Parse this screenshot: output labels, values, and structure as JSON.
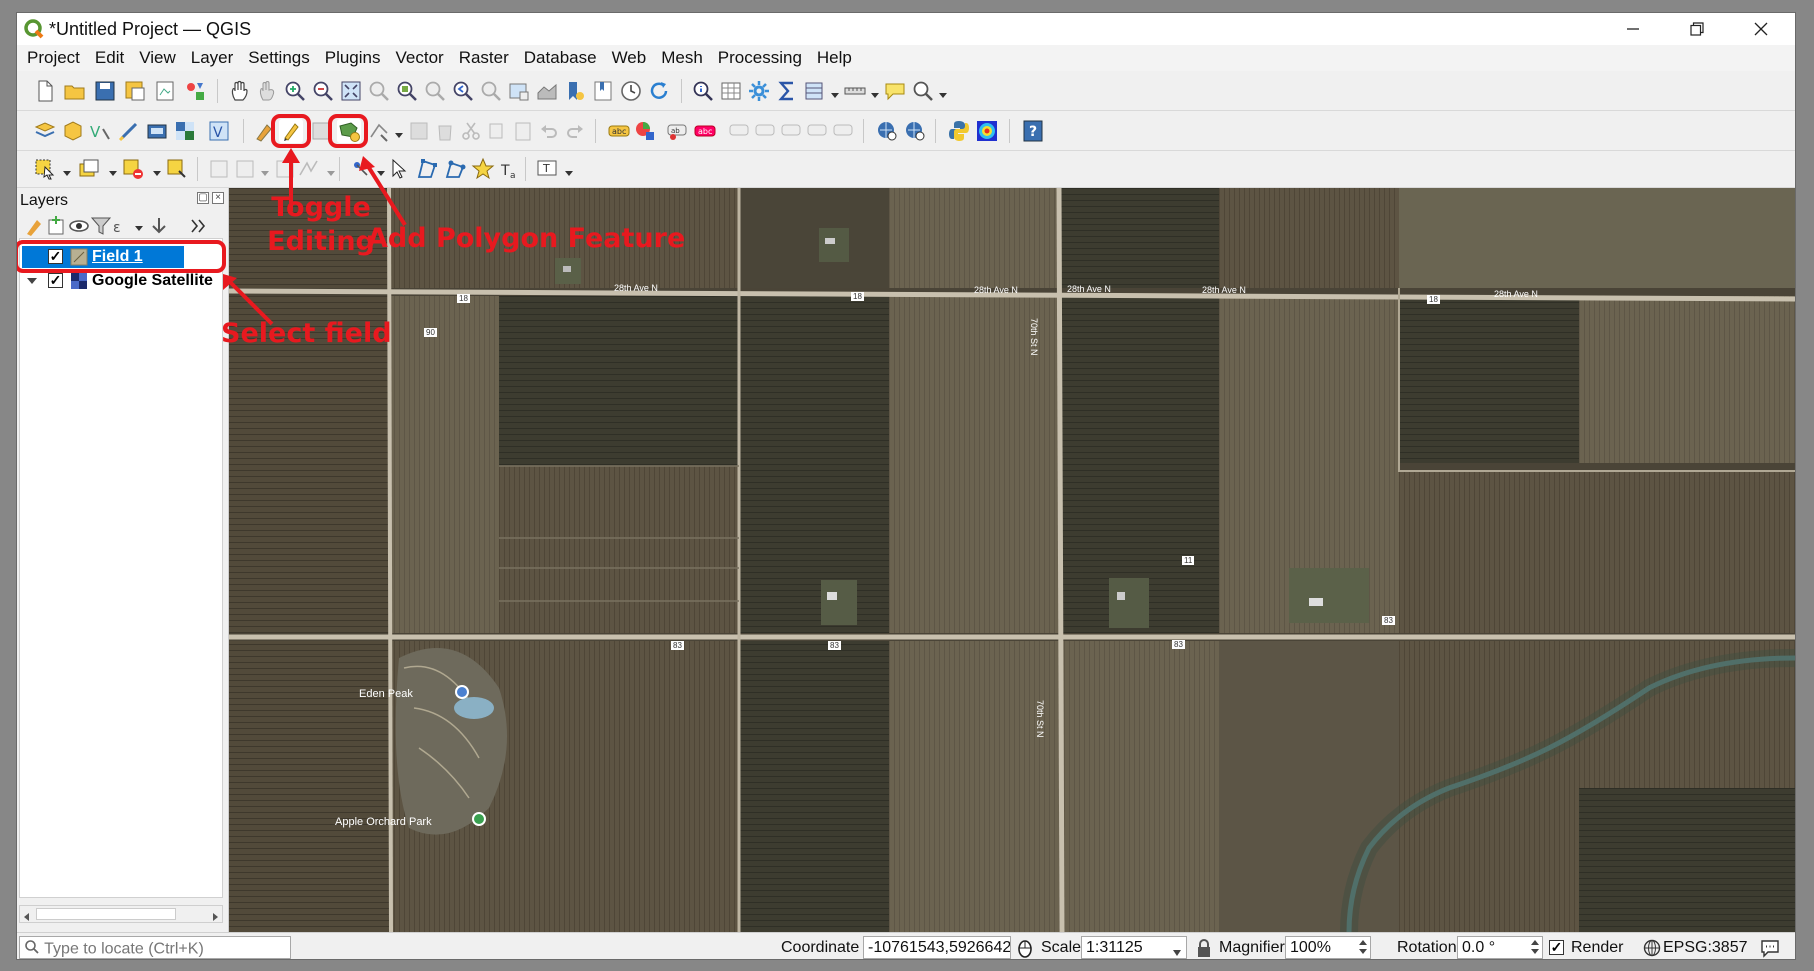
{
  "window": {
    "title": "*Untitled Project — QGIS",
    "controls": {
      "minimize": "—",
      "maximize": "❐",
      "close": "✕"
    }
  },
  "menu": [
    "Project",
    "Edit",
    "View",
    "Layer",
    "Settings",
    "Plugins",
    "Vector",
    "Raster",
    "Database",
    "Web",
    "Mesh",
    "Processing",
    "Help"
  ],
  "layers_panel": {
    "title": "Layers",
    "layers": [
      {
        "name": "Field 1",
        "checked": true,
        "selected": true,
        "icon": "polygon-layer-icon"
      },
      {
        "name": "Google Satellite",
        "checked": true,
        "selected": false,
        "icon": "raster-layer-icon"
      }
    ]
  },
  "map_labels": {
    "roads": [
      "28th Ave N",
      "28th Ave N",
      "28th Ave N",
      "28th Ave N",
      "28th Ave N",
      "70th St N",
      "70th St N"
    ],
    "route_shields": [
      "18",
      "18",
      "18",
      "90",
      "11",
      "83",
      "83",
      "83",
      "83"
    ],
    "places": [
      "Eden Peak",
      "Apple Orchard Park"
    ]
  },
  "annotations": {
    "toggle_editing": "Toggle\nEditing",
    "add_polygon": "Add Polygon Feature",
    "select_field": "Select field",
    "color": "#e8191f"
  },
  "statusbar": {
    "locator_placeholder": "Type to locate (Ctrl+K)",
    "coordinate_label": "Coordinate",
    "coordinate_value": "-10761543,5926642",
    "scale_label": "Scale",
    "scale_value": "1:31125",
    "magnifier_label": "Magnifier",
    "magnifier_value": "100%",
    "rotation_label": "Rotation",
    "rotation_value": "0.0 °",
    "render_label": "Render",
    "render_checked": true,
    "crs": "EPSG:3857"
  }
}
